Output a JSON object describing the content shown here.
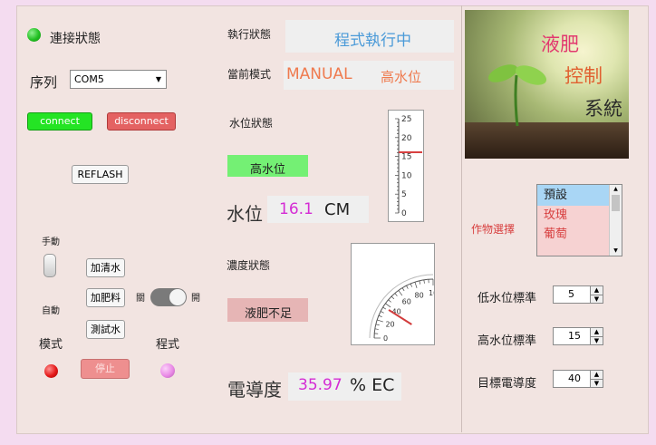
{
  "connection": {
    "label": "連接狀態",
    "status_color": "#22c022"
  },
  "port": {
    "label": "序列",
    "selected": "COM5"
  },
  "buttons": {
    "connect": "connect",
    "disconnect": "disconnect",
    "refresh": "REFLASH",
    "add_water": "加清水",
    "add_fertilizer": "加肥料",
    "test_water": "測試水",
    "stop": "停止"
  },
  "manual": {
    "manual_label": "手動",
    "auto_label": "自動",
    "toggle_off_label": "關",
    "toggle_on_label": "開",
    "mode_label": "模式",
    "program_label": "程式",
    "mode_led_color": "#e41818",
    "program_led_color": "#e98ae6"
  },
  "status": {
    "exec_label": "執行狀態",
    "exec_value": "程式執行中",
    "mode_label": "當前模式",
    "mode_value": "MANUAL",
    "level_value": "高水位",
    "water_status_label": "水位狀態",
    "water_status_value": "高水位",
    "water_level_label": "水位",
    "water_level_value": "16.1",
    "water_level_unit": "CM",
    "conc_status_label": "濃度狀態",
    "conc_status_value": "液肥不足",
    "ec_label": "電導度",
    "ec_value": "35.97",
    "ec_unit": "% EC"
  },
  "tank": {
    "level": 16.1,
    "max": 25,
    "ticks": [
      "25",
      "20",
      "15",
      "10",
      "5",
      "0"
    ]
  },
  "gauge": {
    "value": 35.97,
    "max": 100,
    "ticks": [
      "0",
      "20",
      "40",
      "60",
      "80",
      "100"
    ]
  },
  "banner": {
    "line1": "液肥",
    "line2": "控制",
    "line3": "系統"
  },
  "crop": {
    "label": "作物選擇",
    "options": [
      "預設",
      "玫瑰",
      "葡萄"
    ]
  },
  "settings": {
    "low_label": "低水位標準",
    "low_value": "5",
    "high_label": "高水位標準",
    "high_value": "15",
    "target_label": "目標電導度",
    "target_value": "40"
  }
}
